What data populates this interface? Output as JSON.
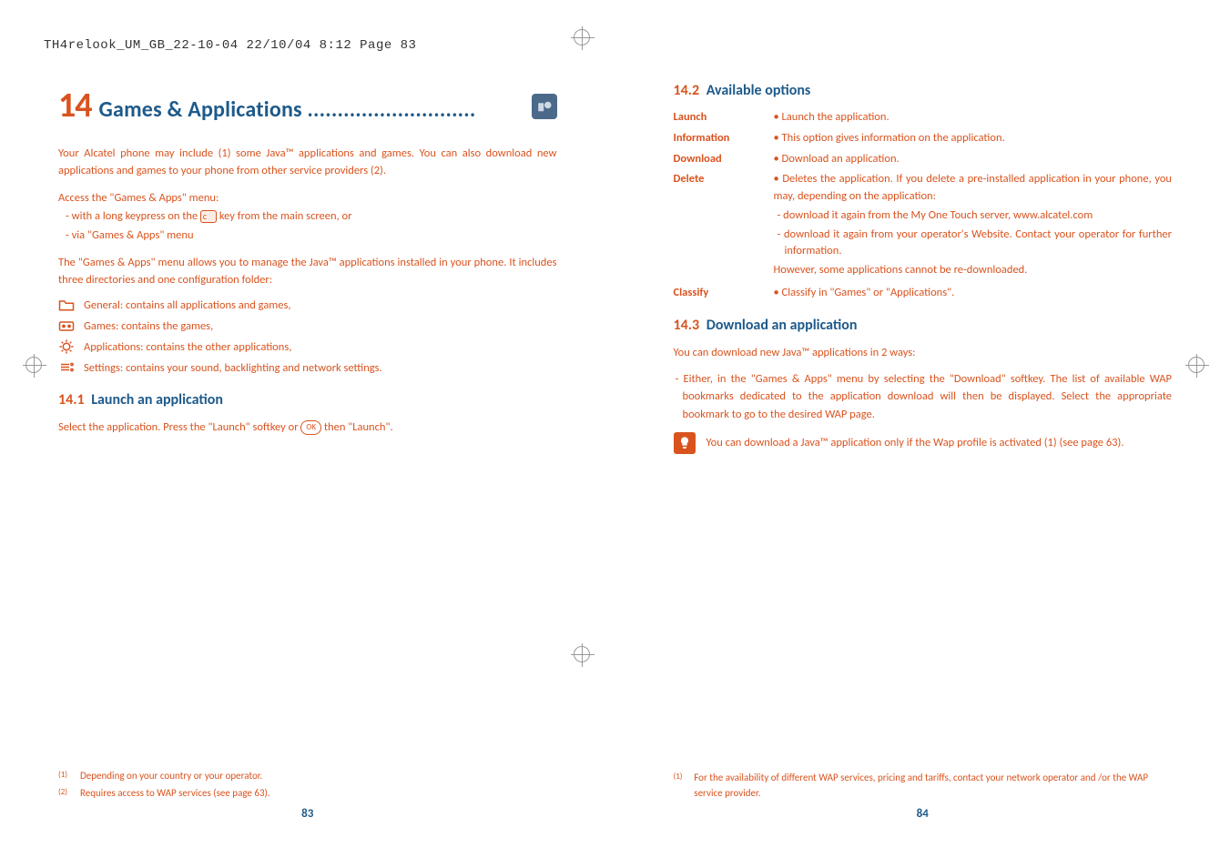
{
  "header": "TH4relook_UM_GB_22-10-04  22/10/04  8:12  Page 83",
  "left": {
    "chapter_num": "14",
    "chapter_title": "Games & Applications ............................",
    "intro": "Your Alcatel phone may include (1) some Java™ applications and games. You can also download new applications and games to your phone from other service providers (2).",
    "access_lead": "Access the \"Games & Apps\" menu:",
    "access_1a": "- with a long keypress on the ",
    "access_1b": " key from the main screen, or",
    "access_2": "- via \"Games & Apps\" menu",
    "para2": "The \"Games & Apps\" menu allows you to manage the Java™ applications installed in your phone. It includes three directories and one configuration folder:",
    "items": {
      "general": "General: contains all applications and games,",
      "games": "Games: contains the games,",
      "applications": "Applications: contains the other applications,",
      "settings": "Settings: contains your sound, backlighting and network settings."
    },
    "sec_num": "14.1",
    "sec_title": "Launch an application",
    "sec_body_a": "Select the application. Press the \"Launch\" softkey or ",
    "sec_body_b": " then \"Launch\".",
    "footnotes": {
      "f1": "Depending on your country or your operator.",
      "f2": "Requires access to WAP services (see page 63)."
    },
    "pagenum": "83"
  },
  "right": {
    "sec2_num": "14.2",
    "sec2_title": "Available options",
    "options": {
      "launch_k": "Launch",
      "launch_v": "• Launch the application.",
      "info_k": "Information",
      "info_v": "• This option gives information on the application.",
      "download_k": "Download",
      "download_v": "• Download an application.",
      "delete_k": "Delete",
      "delete_v": "• Deletes the application. If you delete a pre-installed application in your phone, you may, depending on the application:",
      "delete_s1": "- download it again from the My One Touch server, www.alcatel.com",
      "delete_s2": "- download it again from your operator's Website. Contact your operator for further information.",
      "delete_s3": "However, some applications cannot be re-downloaded.",
      "classify_k": "Classify",
      "classify_v": "• Classify in \"Games\" or \"Applications\"."
    },
    "sec3_num": "14.3",
    "sec3_title": "Download an application",
    "dl_intro": "You can download new Java™ applications in 2 ways:",
    "dl_item1": "- Either, in the \"Games & Apps\" menu by selecting the \"Download\" softkey. The list of available WAP bookmarks dedicated to the application download will then be displayed. Select the appropriate bookmark to go to the desired WAP page.",
    "tip": "You can download a Java™ application only if the Wap profile is activated (1) (see page 63).",
    "footnote": "For the availability of different WAP services, pricing and tariffs, contact your network operator and /or the WAP service provider.",
    "pagenum": "84"
  }
}
